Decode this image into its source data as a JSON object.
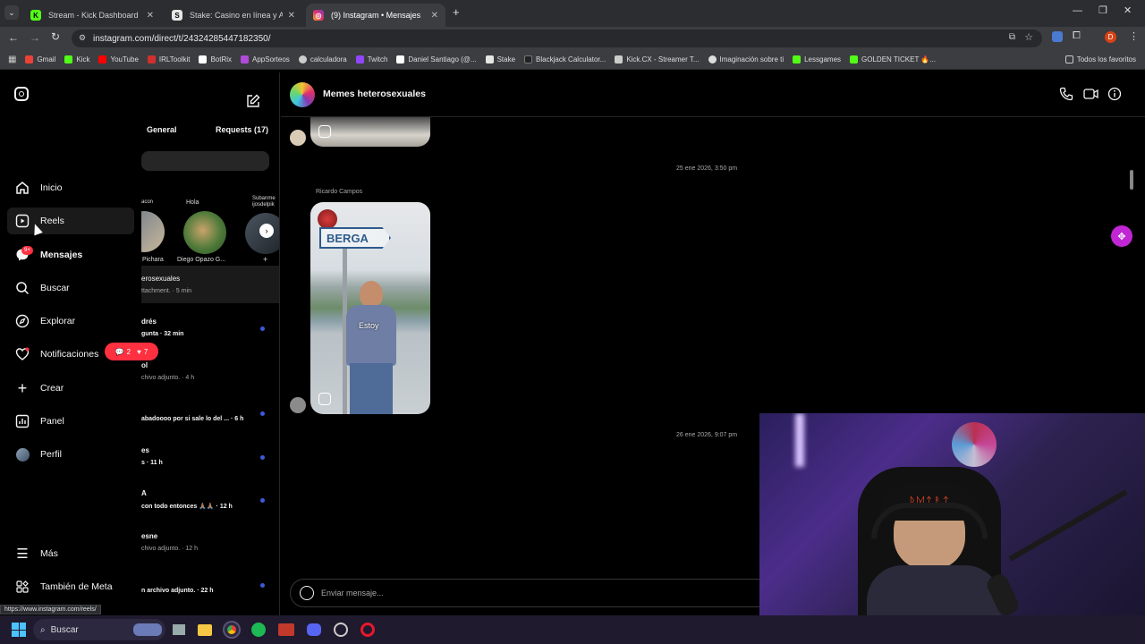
{
  "browser": {
    "tabs": [
      {
        "title": "Stream - Kick Dashboard",
        "fav_color": "#53fc18",
        "fav_letter": "K"
      },
      {
        "title": "Stake: Casino en línea y Apuest",
        "fav_color": "#e6e6e6",
        "fav_letter": "S"
      },
      {
        "title": "(9) Instagram • Mensajes",
        "fav_color": "#e1306c",
        "fav_letter": "◎"
      }
    ],
    "url": "instagram.com/direct/t/24324285447182350/",
    "bookmarks": [
      {
        "label": "Gmail",
        "color": "#ea4335"
      },
      {
        "label": "Kick",
        "color": "#53fc18"
      },
      {
        "label": "YouTube",
        "color": "#ff0000"
      },
      {
        "label": "IRLToolkit",
        "color": "#d0312d"
      },
      {
        "label": "BotRix",
        "color": "#ffffff"
      },
      {
        "label": "AppSorteos",
        "color": "#b04bd9"
      },
      {
        "label": "calculadora",
        "color": "#cccccc"
      },
      {
        "label": "Twitch",
        "color": "#9146ff"
      },
      {
        "label": "Daniel Santiago (@...",
        "color": "#ffffff"
      },
      {
        "label": "Stake",
        "color": "#e6e6e6"
      },
      {
        "label": "Blackjack Calculator...",
        "color": "#222222"
      },
      {
        "label": "Kick.CX - Streamer T...",
        "color": "#cccccc"
      },
      {
        "label": "Imaginación sobre ti",
        "color": "#dddddd"
      },
      {
        "label": "Lessgames",
        "color": "#53fc18"
      },
      {
        "label": "GOLDEN TICKET 🔥...",
        "color": "#53fc18"
      }
    ],
    "all_bookmarks": "Todos los favoritos",
    "status_url": "https://www.instagram.com/reels/"
  },
  "nav": {
    "items": [
      {
        "label": "Inicio",
        "icon": "home-icon"
      },
      {
        "label": "Reels",
        "icon": "reels-icon"
      },
      {
        "label": "Mensajes",
        "icon": "messenger-icon"
      },
      {
        "label": "Buscar",
        "icon": "search-icon"
      },
      {
        "label": "Explorar",
        "icon": "compass-icon"
      },
      {
        "label": "Notificaciones",
        "icon": "heart-icon"
      },
      {
        "label": "Crear",
        "icon": "plus-icon"
      },
      {
        "label": "Panel",
        "icon": "chart-icon"
      },
      {
        "label": "Perfil",
        "icon": "avatar-icon"
      }
    ],
    "more": "Más",
    "meta": "También de Meta",
    "messages_badge": "9+",
    "notif_comments": "2",
    "notif_likes": "7"
  },
  "inbox": {
    "tab_general": "General",
    "tab_requests": "Requests (17)",
    "notes": [
      {
        "bubble": "acon",
        "name": "Pichara"
      },
      {
        "bubble": "Hola",
        "name": "Diego Opazo G..."
      },
      {
        "bubble": "Subanme ijosdelpik",
        "name": ""
      }
    ],
    "conversations": [
      {
        "name": "erosexuales",
        "sub": "ttachment. · 5 min",
        "unread": false,
        "active": true
      },
      {
        "name": "drés",
        "sub": "gunta · 32 min",
        "unread": true
      },
      {
        "name": "ol",
        "sub": "chivo adjunto. · 4 h",
        "unread": false
      },
      {
        "name": "",
        "sub": "abadoooo por si sale lo del ... · 6 h",
        "unread": true
      },
      {
        "name": "es",
        "sub": "s · 11 h",
        "unread": true
      },
      {
        "name": "A",
        "sub": "con todo entonces 🙏🏽🙏🏽 · 12 h",
        "unread": true
      },
      {
        "name": "esne",
        "sub": "chivo adjunto. · 12 h",
        "unread": false
      },
      {
        "name": "",
        "sub": "n archivo adjunto. · 22 h",
        "unread": true
      }
    ]
  },
  "chat": {
    "title": "Memes heterosexuales",
    "timestamp1": "25 ene 2026, 3:50 pm",
    "sender": "Ricardo Campos",
    "reel_sign": "BERGA",
    "reel_caption": "Estoy",
    "timestamp2": "26 ene 2026, 9:07 pm",
    "input_placeholder": "Enviar mensaje..."
  },
  "taskbar": {
    "search": "Buscar"
  },
  "webcam": {
    "cap_text": "ᚱᛞᛏᚨᛏ"
  }
}
